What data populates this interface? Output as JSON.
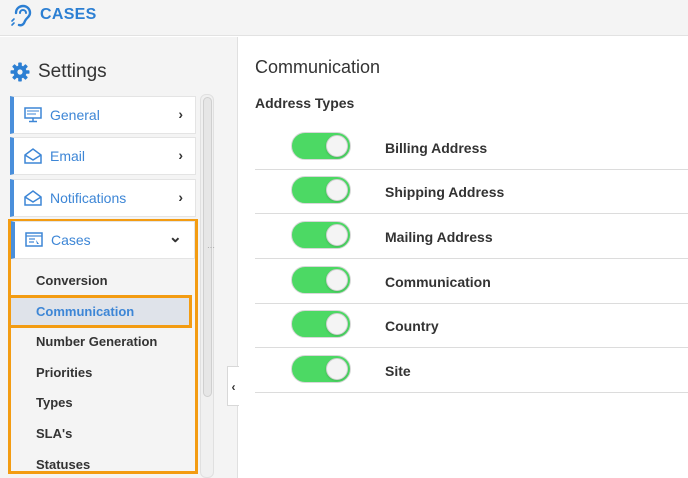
{
  "header": {
    "app_title": "CASES",
    "logo_icon": "ear-logo-icon",
    "accent": "#2c7fd3"
  },
  "sidebar": {
    "title": "Settings",
    "title_icon": "gear-icon",
    "items": [
      {
        "label": "General",
        "icon": "monitor-icon",
        "arrow": "›"
      },
      {
        "label": "Email",
        "icon": "envelope-open-icon",
        "arrow": "›"
      },
      {
        "label": "Notifications",
        "icon": "envelope-open-icon",
        "arrow": "›"
      },
      {
        "label": "Cases",
        "icon": "list-window-icon",
        "arrow": "⌄"
      }
    ],
    "sub_items": [
      "Conversion",
      "Communication",
      "Number Generation",
      "Priorities",
      "Types",
      "SLA's",
      "Statuses"
    ],
    "active_sub_item": "Communication",
    "highlight_color": "#f39c12",
    "collapse_arrow": "‹"
  },
  "main": {
    "title": "Communication",
    "section": "Address Types",
    "toggle_color": "#4cd964",
    "rows": [
      {
        "label": "Billing Address",
        "enabled": true
      },
      {
        "label": "Shipping Address",
        "enabled": true
      },
      {
        "label": "Mailing Address",
        "enabled": true
      },
      {
        "label": "Communication",
        "enabled": true
      },
      {
        "label": "Country",
        "enabled": true
      },
      {
        "label": "Site",
        "enabled": true
      }
    ]
  }
}
